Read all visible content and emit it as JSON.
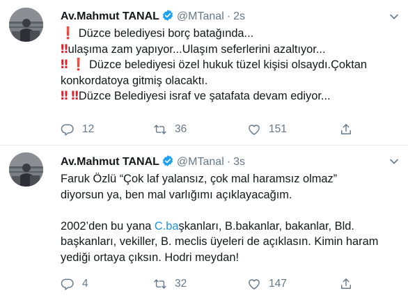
{
  "tweets": [
    {
      "name": "Av.Mahmut TANAL",
      "handle": "@MTanal",
      "separator": "·",
      "time": "2s",
      "body": {
        "l1": "Düzce belediyesi borç batağında...",
        "l2": "ulaşıma zam yapıyor...Ulaşım seferlerini azaltıyor...",
        "l3": "Düzce belediyesi özel hukuk tüzel kişisi olsaydı.Çoktan",
        "l4": "konkordatoya gitmiş olacaktı.",
        "l5": "Düzce Belediyesi israf ve şatafata devam ediyor..."
      },
      "emoji": {
        "single": "❗",
        "double": "‼"
      },
      "replies": "12",
      "retweets": "36",
      "likes": "151"
    },
    {
      "name": "Av.Mahmut TANAL",
      "handle": "@MTanal",
      "separator": "·",
      "time": "3s",
      "body": {
        "l1": "Faruk Özlü “Çok laf yalansız, çok mal haramsız olmaz”",
        "l2": "diyorsun ya, ben mal varlığımı açıklayacağım.",
        "l3_pre": "2002’den bu yana ",
        "l3_link": "C.ba",
        "l3_post": "şkanları, B.bakanlar, bakanlar, Bld.",
        "l4": "başkanları, vekiller, B. meclis üyeleri de açıklasın. Kimin haram",
        "l5": "yediği ortaya çıksın. Hodri meydan!"
      },
      "replies": "4",
      "retweets": "32",
      "likes": "147"
    }
  ],
  "colors": {
    "text": "#14171a",
    "muted": "#657786",
    "link": "#1b95e0",
    "verified": "#1da1f2",
    "emoji_red": "#e0202b",
    "divider": "#e6ecf0"
  },
  "icons": [
    "verified-badge-icon",
    "caret-down-icon",
    "reply-icon",
    "retweet-icon",
    "like-icon",
    "share-icon"
  ]
}
